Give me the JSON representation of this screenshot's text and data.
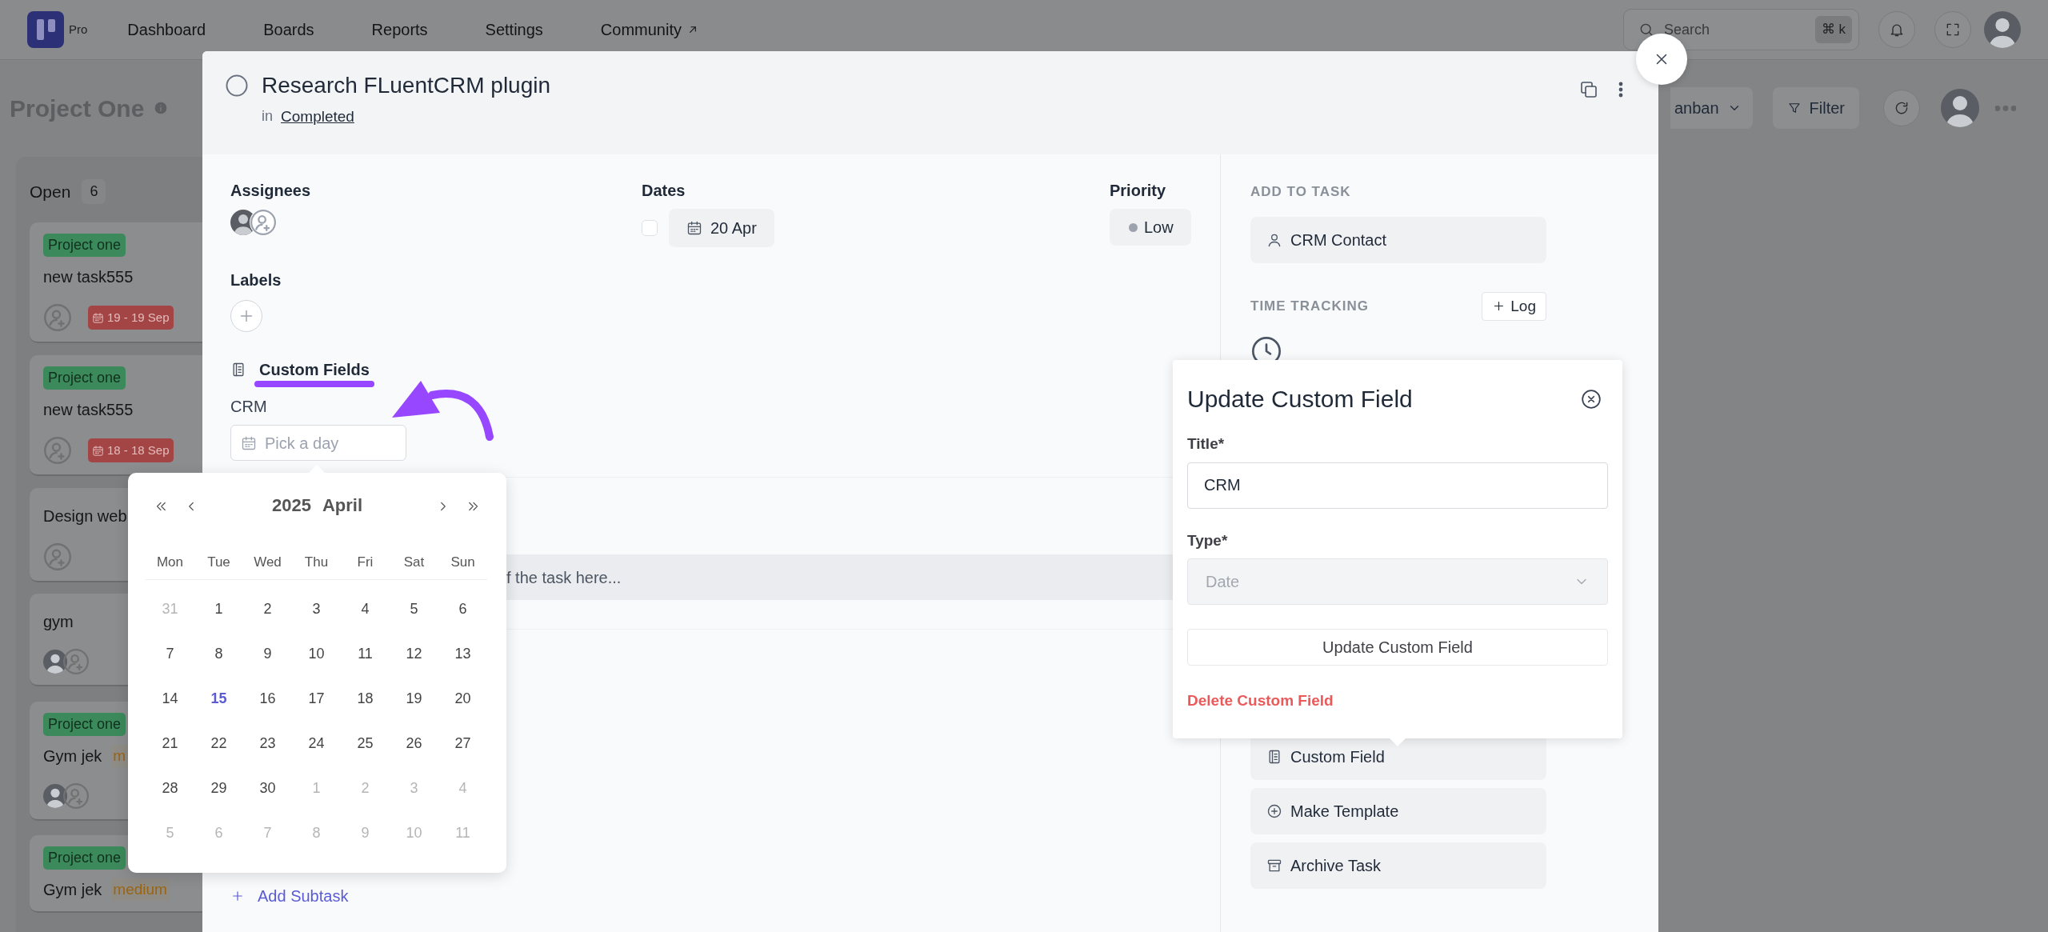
{
  "top_nav": {
    "logo_badge": "Pro",
    "items": [
      {
        "label": "Dashboard",
        "external": false
      },
      {
        "label": "Boards",
        "external": false
      },
      {
        "label": "Reports",
        "external": false
      },
      {
        "label": "Settings",
        "external": false
      },
      {
        "label": "Community",
        "external": true
      }
    ],
    "search": {
      "placeholder": "Search",
      "shortcut": "⌘ k"
    }
  },
  "board": {
    "title": "Project One",
    "view_button": "anban",
    "filter_button": "Filter",
    "column": {
      "title": "Open",
      "count": "6",
      "cards": [
        {
          "tag": "Project one",
          "title": "new task555",
          "date": "19 - 19 Sep",
          "assignee": {
            "kind": "empty"
          }
        },
        {
          "tag": "Project one",
          "title": "new task555",
          "date": "18 - 18 Sep",
          "assignee": {
            "kind": "empty"
          }
        },
        {
          "title": "Design web",
          "assignee": {
            "kind": "empty"
          }
        },
        {
          "title": "gym",
          "assignee": {
            "kind": "avatar"
          }
        },
        {
          "tag": "Project one",
          "title": "Gym jek",
          "priority": "m",
          "assignee": {
            "kind": "avatar"
          }
        },
        {
          "tag": "Project one",
          "title": "Gym jek",
          "priority": "medium"
        }
      ]
    }
  },
  "task_modal": {
    "title": "Research FLuentCRM plugin",
    "completed": false,
    "stage_prefix": "in",
    "stage": "Completed",
    "assignees_label": "Assignees",
    "dates_label": "Dates",
    "date_checked": false,
    "due_date": "20 Apr",
    "priority_label": "Priority",
    "priority": "Low",
    "labels_label": "Labels",
    "custom_fields": {
      "heading": "Custom Fields",
      "fields": [
        {
          "label": "CRM",
          "placeholder": "Pick a day"
        }
      ]
    },
    "description_placeholder": "f the task here...",
    "add_subtask": "Add Subtask",
    "sidebar": {
      "add_to_task_heading": "ADD TO TASK",
      "crm_contact": "CRM Contact",
      "time_tracking_heading": "TIME TRACKING",
      "log_button": "Log",
      "actions": [
        {
          "label": "Custom Field",
          "kind": "custom-field"
        },
        {
          "label": "Make Template",
          "kind": "template"
        },
        {
          "label": "Archive Task",
          "kind": "archive"
        }
      ]
    }
  },
  "date_picker": {
    "year": "2025",
    "month": "April",
    "weekdays": [
      "Mon",
      "Tue",
      "Wed",
      "Thu",
      "Fri",
      "Sat",
      "Sun"
    ],
    "weeks": [
      [
        {
          "day": "31",
          "muted": true,
          "selected": false
        },
        {
          "day": "1",
          "muted": false,
          "selected": false
        },
        {
          "day": "2",
          "muted": false,
          "selected": false
        },
        {
          "day": "3",
          "muted": false,
          "selected": false
        },
        {
          "day": "4",
          "muted": false,
          "selected": false
        },
        {
          "day": "5",
          "muted": false,
          "selected": false
        },
        {
          "day": "6",
          "muted": false,
          "selected": false
        }
      ],
      [
        {
          "day": "7",
          "muted": false,
          "selected": false
        },
        {
          "day": "8",
          "muted": false,
          "selected": false
        },
        {
          "day": "9",
          "muted": false,
          "selected": false
        },
        {
          "day": "10",
          "muted": false,
          "selected": false
        },
        {
          "day": "11",
          "muted": false,
          "selected": false
        },
        {
          "day": "12",
          "muted": false,
          "selected": false
        },
        {
          "day": "13",
          "muted": false,
          "selected": false
        }
      ],
      [
        {
          "day": "14",
          "muted": false,
          "selected": false
        },
        {
          "day": "15",
          "muted": false,
          "selected": true
        },
        {
          "day": "16",
          "muted": false,
          "selected": false
        },
        {
          "day": "17",
          "muted": false,
          "selected": false
        },
        {
          "day": "18",
          "muted": false,
          "selected": false
        },
        {
          "day": "19",
          "muted": false,
          "selected": false
        },
        {
          "day": "20",
          "muted": false,
          "selected": false
        }
      ],
      [
        {
          "day": "21",
          "muted": false,
          "selected": false
        },
        {
          "day": "22",
          "muted": false,
          "selected": false
        },
        {
          "day": "23",
          "muted": false,
          "selected": false
        },
        {
          "day": "24",
          "muted": false,
          "selected": false
        },
        {
          "day": "25",
          "muted": false,
          "selected": false
        },
        {
          "day": "26",
          "muted": false,
          "selected": false
        },
        {
          "day": "27",
          "muted": false,
          "selected": false
        }
      ],
      [
        {
          "day": "28",
          "muted": false,
          "selected": false
        },
        {
          "day": "29",
          "muted": false,
          "selected": false
        },
        {
          "day": "30",
          "muted": false,
          "selected": false
        },
        {
          "day": "1",
          "muted": true,
          "selected": false
        },
        {
          "day": "2",
          "muted": true,
          "selected": false
        },
        {
          "day": "3",
          "muted": true,
          "selected": false
        },
        {
          "day": "4",
          "muted": true,
          "selected": false
        }
      ],
      [
        {
          "day": "5",
          "muted": true,
          "selected": false
        },
        {
          "day": "6",
          "muted": true,
          "selected": false
        },
        {
          "day": "7",
          "muted": true,
          "selected": false
        },
        {
          "day": "8",
          "muted": true,
          "selected": false
        },
        {
          "day": "9",
          "muted": true,
          "selected": false
        },
        {
          "day": "10",
          "muted": true,
          "selected": false
        },
        {
          "day": "11",
          "muted": true,
          "selected": false
        }
      ]
    ]
  },
  "update_popover": {
    "title": "Update Custom Field",
    "title_label": "Title*",
    "title_value": "CRM",
    "type_label": "Type*",
    "type_value": "Date",
    "type_disabled": true,
    "submit": "Update Custom Field",
    "delete": "Delete Custom Field"
  }
}
